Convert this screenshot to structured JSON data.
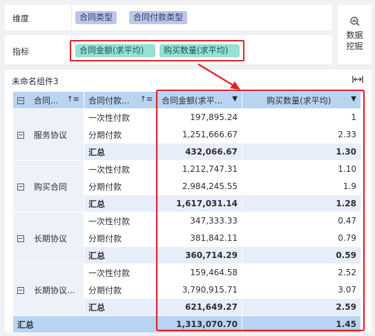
{
  "config": {
    "dimension_label": "维度",
    "dimensions": [
      "合同类型",
      "合同付款类型"
    ],
    "metric_label": "指标",
    "metrics": [
      "合同金额(求平均)",
      "购买数量(求平均)"
    ]
  },
  "side": {
    "label_line1": "数据",
    "label_line2": "挖掘",
    "icon": "data-mining-icon"
  },
  "widget": {
    "title": "未命名组件3",
    "expand_icon": "fit-width-icon"
  },
  "table": {
    "headers": [
      "合同...",
      "合同付款...",
      "合同金额(求平...",
      "购买数量(求平均)"
    ],
    "groups": [
      {
        "name": "服务协议",
        "rows": [
          {
            "type": "一次性付款",
            "amount": "197,895.24",
            "qty": "1"
          },
          {
            "type": "分期付款",
            "amount": "1,251,666.67",
            "qty": "2.33"
          },
          {
            "type": "汇总",
            "amount": "432,066.67",
            "qty": "1.30"
          }
        ]
      },
      {
        "name": "购买合同",
        "rows": [
          {
            "type": "一次性付款",
            "amount": "1,212,747.31",
            "qty": "1.10"
          },
          {
            "type": "分期付款",
            "amount": "2,984,245.55",
            "qty": "1.9"
          },
          {
            "type": "汇总",
            "amount": "1,617,031.14",
            "qty": "1.28"
          }
        ]
      },
      {
        "name": "长期协议",
        "rows": [
          {
            "type": "一次性付款",
            "amount": "347,333.33",
            "qty": "0.47"
          },
          {
            "type": "分期付款",
            "amount": "381,842.11",
            "qty": "0.79"
          },
          {
            "type": "汇总",
            "amount": "360,714.29",
            "qty": "0.59"
          }
        ]
      },
      {
        "name": "长期协议...",
        "rows": [
          {
            "type": "一次性付款",
            "amount": "159,464.58",
            "qty": "2.52"
          },
          {
            "type": "分期付款",
            "amount": "3,790,915.71",
            "qty": "3.07"
          },
          {
            "type": "汇总",
            "amount": "621,649.27",
            "qty": "2.59"
          }
        ]
      }
    ],
    "grand_total": {
      "label": "汇总",
      "amount": "1,313,070.70",
      "qty": "1.45"
    }
  },
  "colors": {
    "highlight": "#e0202a",
    "dimension_chip": "#bcc6e8",
    "metric_chip": "#97e0d6",
    "header": "#b9d4f3"
  }
}
